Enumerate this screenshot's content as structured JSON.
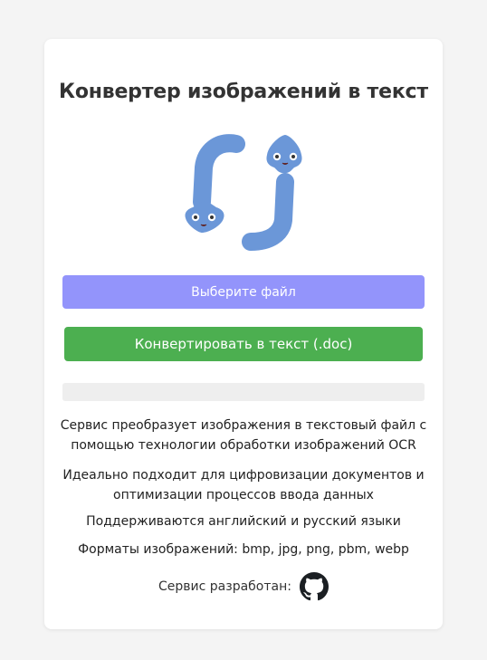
{
  "header": {
    "title": "Конвертер изображений в текст"
  },
  "actions": {
    "select_label": "Выберите файл",
    "convert_label": "Конвертировать в текст (.doc)"
  },
  "progress": {
    "fraction": 0
  },
  "description": {
    "line1": "Сервис преобразует изображения в текстовый файл с помощью технологии обработки изображений OCR",
    "line2": "Идеально подходит для цифровизации документов и оптимизации процессов ввода данных",
    "line3": "Поддерживаются английский и русский языки",
    "line4": "Форматы изображений: bmp, jpg, png, pbm, webp"
  },
  "footer": {
    "developer_label": "Сервис разработан:",
    "link_icon": "github-icon"
  },
  "colors": {
    "select_button": "#9394fb",
    "convert_button": "#4caf50",
    "logo": "#6b97d8",
    "progress_track": "#eeeeee"
  }
}
